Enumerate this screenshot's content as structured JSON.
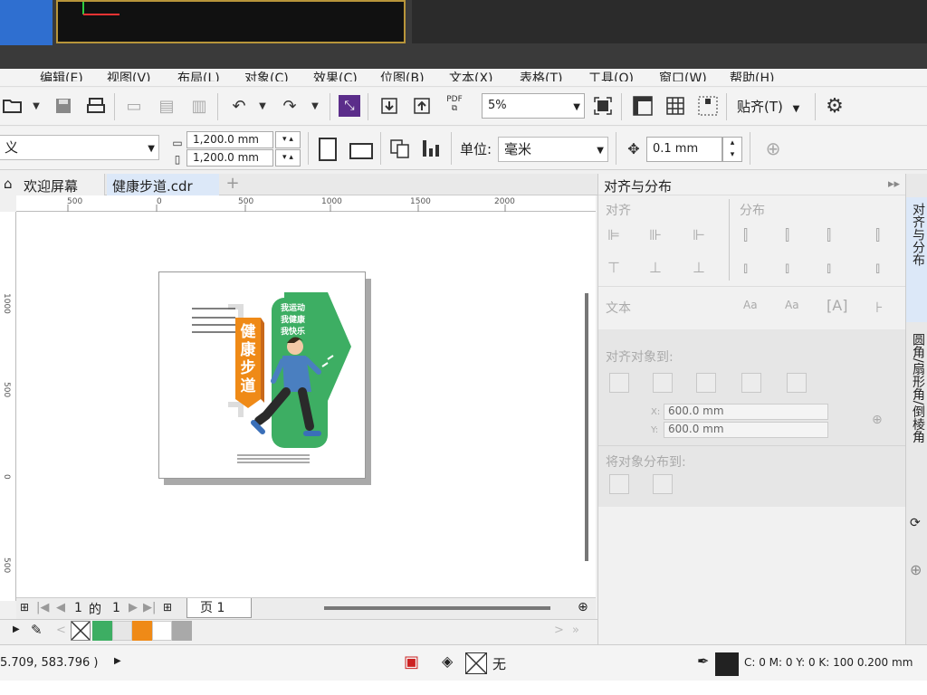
{
  "toolbar": {
    "zoom_value": "5%",
    "snap_label": "贴齐(T)",
    "pdf_label": "PDF",
    "width_value": "1,200.0 mm",
    "height_value": "1,200.0 mm",
    "unit_label": "单位:",
    "unit_value": "毫米",
    "nudge_value": "0.1 mm",
    "preset_value": "义"
  },
  "tabs": {
    "welcome": "欢迎屏幕",
    "document": "健康步道.cdr"
  },
  "ruler": {
    "h_ticks": [
      "500",
      "0",
      "500",
      "1000",
      "1500",
      "2000"
    ],
    "v_ticks": [
      "1000",
      "500",
      "0",
      "500"
    ]
  },
  "artwork": {
    "lines_title": "我运动",
    "line2": "我健康",
    "line3": "我快乐",
    "vertical_title": "健康步道"
  },
  "pager": {
    "current": "1",
    "of": "的",
    "total": "1",
    "page_tab": "页 1"
  },
  "panel": {
    "title": "对齐与分布",
    "align": "对齐",
    "distribute": "分布",
    "text": "文本",
    "align_to": "对齐对象到:",
    "x_value": "600.0 mm",
    "y_value": "600.0 mm",
    "x_label": "X:",
    "y_label": "Y:",
    "distribute_to": "将对象分布到:"
  },
  "docker_tabs": {
    "t1": "对齐与分布",
    "t2": "圆角/扇形角/倒棱角"
  },
  "status": {
    "coords": "5.709, 583.796 )",
    "fill_none": "无",
    "outline_info": "C: 0 M: 0 Y: 0 K: 100  0.200 mm"
  },
  "colors": {
    "green": "#3dae63",
    "orange": "#ef8a17",
    "accent": "#2f6fd0"
  }
}
